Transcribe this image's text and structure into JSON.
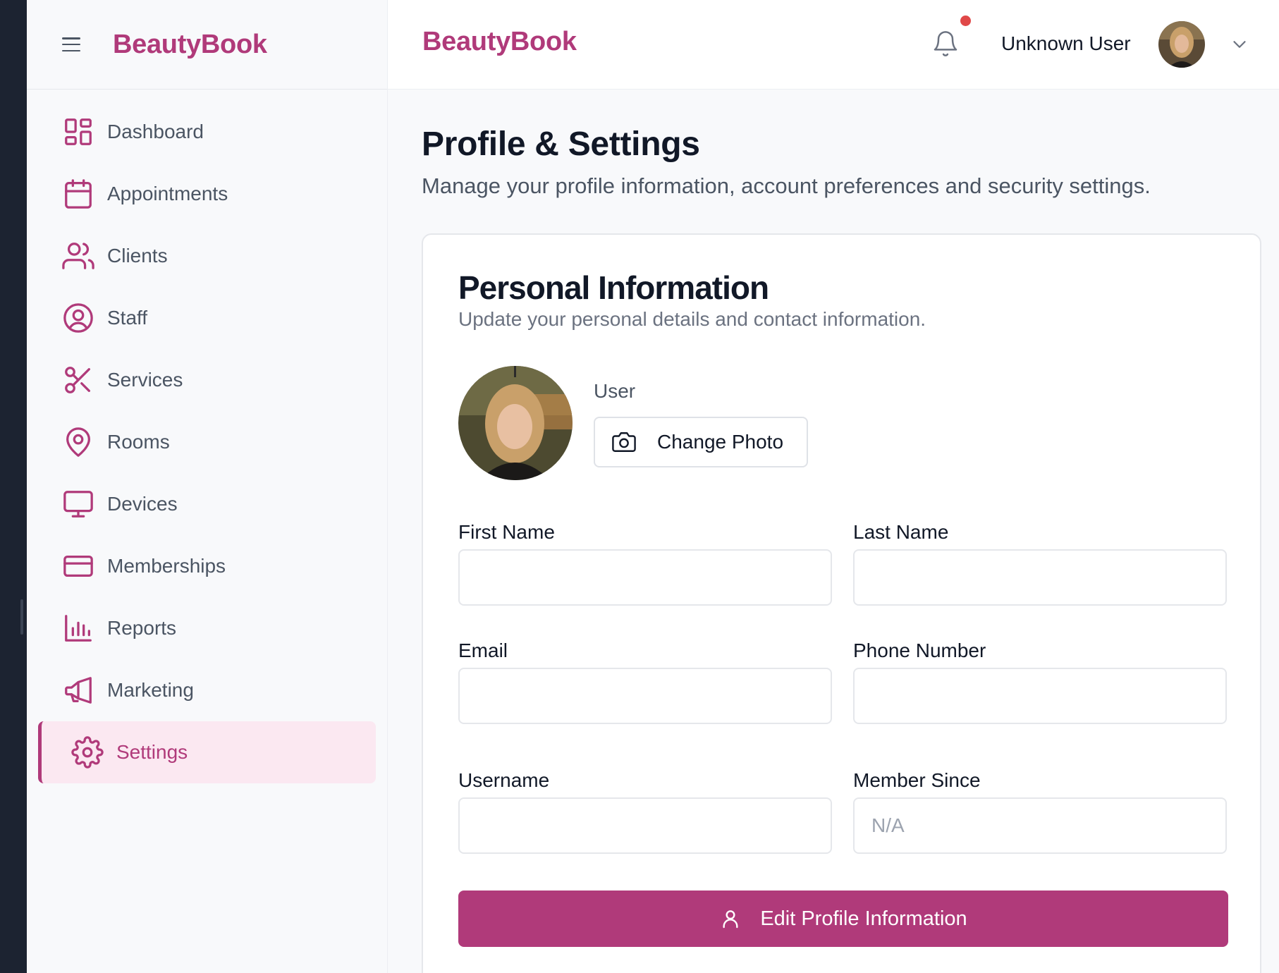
{
  "brand": "BeautyBook",
  "colors": {
    "accent": "#b03a7a",
    "active_bg": "#fbe8f1",
    "notification": "#e04848"
  },
  "sidebar": {
    "items": [
      {
        "label": "Dashboard",
        "icon": "dashboard-grid-icon"
      },
      {
        "label": "Appointments",
        "icon": "calendar-icon"
      },
      {
        "label": "Clients",
        "icon": "users-icon"
      },
      {
        "label": "Staff",
        "icon": "user-circle-icon"
      },
      {
        "label": "Services",
        "icon": "scissors-icon"
      },
      {
        "label": "Rooms",
        "icon": "map-pin-icon"
      },
      {
        "label": "Devices",
        "icon": "monitor-icon"
      },
      {
        "label": "Memberships",
        "icon": "credit-card-icon"
      },
      {
        "label": "Reports",
        "icon": "bar-chart-icon"
      },
      {
        "label": "Marketing",
        "icon": "megaphone-icon"
      },
      {
        "label": "Settings",
        "icon": "gear-icon",
        "active": true
      }
    ]
  },
  "header": {
    "user_name": "Unknown User",
    "has_notification": true
  },
  "page": {
    "title": "Profile & Settings",
    "subtitle": "Manage your profile information, account preferences and security settings."
  },
  "personal_info": {
    "title": "Personal Information",
    "subtitle": "Update your personal details and contact information.",
    "role": "User",
    "change_photo_label": "Change Photo",
    "fields": {
      "first_name": {
        "label": "First Name",
        "value": "",
        "placeholder": ""
      },
      "last_name": {
        "label": "Last Name",
        "value": "",
        "placeholder": ""
      },
      "email": {
        "label": "Email",
        "value": "",
        "placeholder": ""
      },
      "phone": {
        "label": "Phone Number",
        "value": "",
        "placeholder": ""
      },
      "username": {
        "label": "Username",
        "value": "",
        "placeholder": ""
      },
      "member_since": {
        "label": "Member Since",
        "value": "",
        "placeholder": "N/A"
      }
    },
    "edit_button_label": "Edit Profile Information"
  }
}
